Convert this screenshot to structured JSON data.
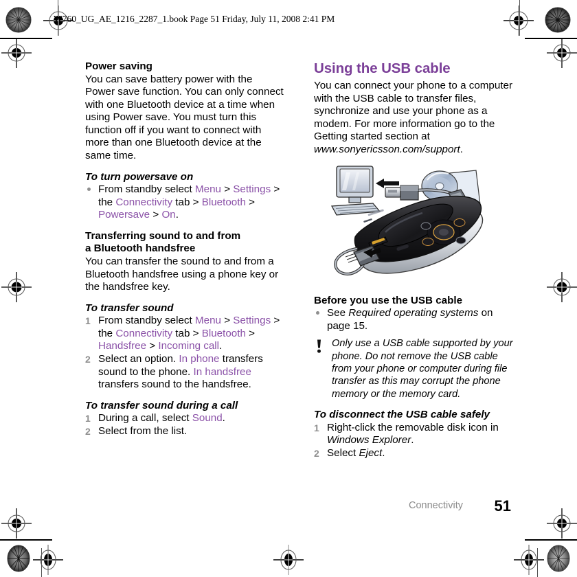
{
  "header": {
    "book_line": "W760_UG_AE_1216_2287_1.book  Page 51  Friday, July 11, 2008  2:41 PM"
  },
  "left_column": {
    "power_saving": {
      "heading": "Power saving",
      "body": "You can save battery power with the Power save function. You can only connect with one Bluetooth device at a time when using Power save. You must turn this function off if you want to connect with more than one Bluetooth device at the same time."
    },
    "to_turn_powersave_on": {
      "heading": "To turn powersave on",
      "step1": {
        "t1": "From standby select ",
        "l1": "Menu",
        "t2": " > ",
        "l2": "Settings",
        "t3": " > the ",
        "l3": "Connectivity",
        "t4": " tab > ",
        "l4": "Bluetooth",
        "t5": " > ",
        "l5": "Powersave",
        "t6": " > ",
        "l6": "On",
        "t7": "."
      }
    },
    "transferring_sound": {
      "heading_line1": "Transferring sound to and from",
      "heading_line2": "a Bluetooth handsfree",
      "body": "You can transfer the sound to and from a Bluetooth handsfree using a phone key or the handsfree key."
    },
    "to_transfer_sound": {
      "heading": "To transfer sound",
      "step1": {
        "num": "1",
        "t1": "From standby select ",
        "l1": "Menu",
        "t2": " > ",
        "l2": "Settings",
        "t3": " > the ",
        "l3": "Connectivity",
        "t4": " tab > ",
        "l4": "Bluetooth",
        "t5": " > ",
        "l5": "Handsfree",
        "t6": " > ",
        "l6": "Incoming call",
        "t7": "."
      },
      "step2": {
        "num": "2",
        "t1": "Select an option. ",
        "l1": "In phone",
        "t2": " transfers sound to the phone. ",
        "l2": "In handsfree",
        "t3": " transfers sound to the handsfree."
      }
    },
    "to_transfer_during_call": {
      "heading": "To transfer sound during a call",
      "step1": {
        "num": "1",
        "t1": "During a call, select ",
        "l1": "Sound",
        "t2": "."
      },
      "step2": {
        "num": "2",
        "t1": "Select from the list."
      }
    }
  },
  "right_column": {
    "usb_section": {
      "heading": "Using the USB cable",
      "body_part1": "You can connect your phone to a computer with the USB cable to transfer files, synchronize and use your phone as a modem. For more information go to the Getting started section at ",
      "body_url": "www.sonyericsson.com/support",
      "body_end": "."
    },
    "illustration": {
      "alt": "Phone connected with USB cable to a computer and CD",
      "icons": [
        "computer-monitor-icon",
        "usb-connector-icon",
        "cd-disc-icon",
        "mobile-phone-icon",
        "arrow-icon"
      ]
    },
    "before_you_use": {
      "heading": "Before you use the USB cable",
      "bullet1": {
        "t1": "See ",
        "i1": "Required operating systems",
        "t2": " on page 15."
      }
    },
    "note": {
      "icon": "exclamation-warning-icon",
      "text": "Only use a USB cable supported by your phone. Do not remove the USB cable from your phone or computer during file transfer as this may corrupt the phone memory or the memory card."
    },
    "to_disconnect": {
      "heading": "To disconnect the USB cable safely",
      "step1": {
        "num": "1",
        "t1": "Right-click the removable disk icon in ",
        "i1": "Windows Explorer",
        "t2": "."
      },
      "step2": {
        "num": "2",
        "t1": "Select ",
        "i1": "Eject",
        "t2": "."
      }
    }
  },
  "footer": {
    "section": "Connectivity",
    "page_number": "51"
  },
  "colors": {
    "link_purple": "#8B52A8",
    "heading_purple": "#7B3F98",
    "marker_gray": "#8F8F8F",
    "footer_gray": "#8A8A8A"
  }
}
